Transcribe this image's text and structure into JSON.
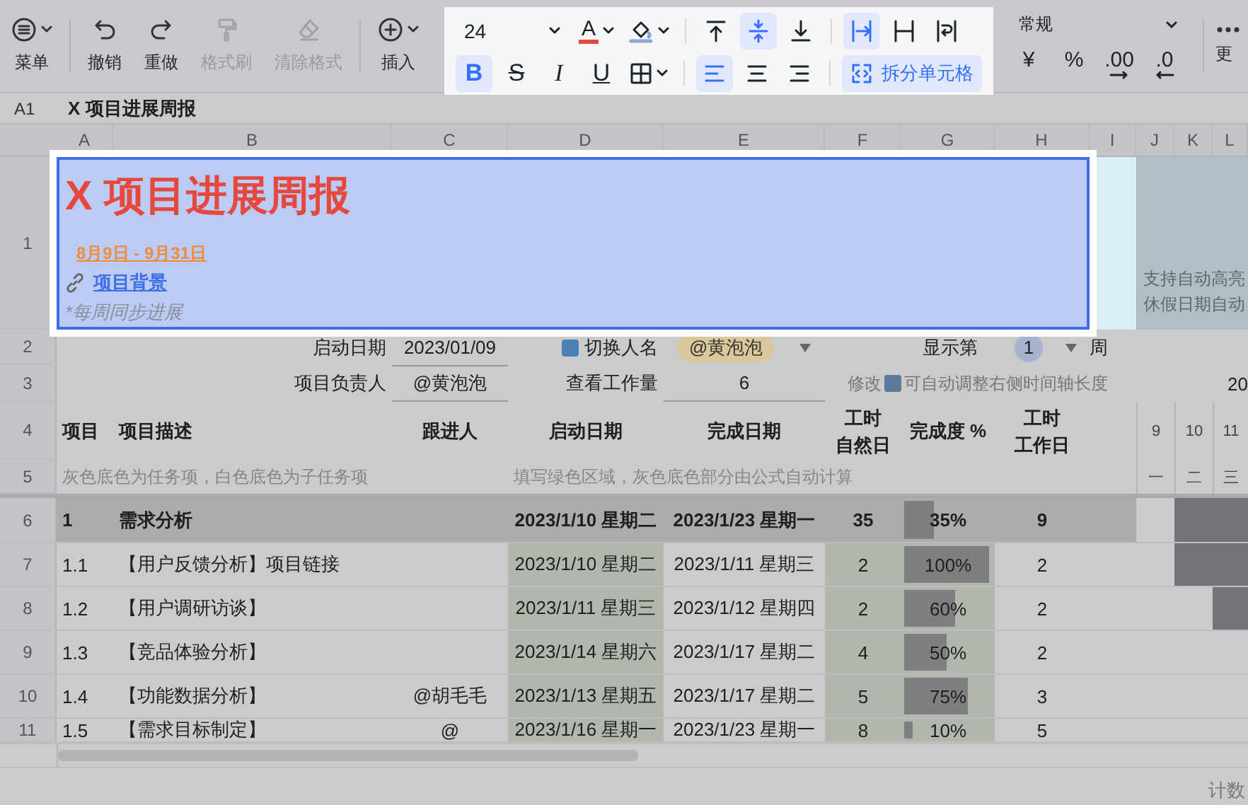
{
  "toolbar": {
    "items": [
      {
        "kind": "menu",
        "label": "菜单",
        "disabled": false
      },
      {
        "kind": "undo",
        "label": "撤销",
        "disabled": false
      },
      {
        "kind": "redo",
        "label": "重做",
        "disabled": false
      },
      {
        "kind": "painter",
        "label": "格式刷",
        "disabled": true
      },
      {
        "kind": "clear",
        "label": "清除格式",
        "disabled": true
      },
      {
        "kind": "insert",
        "label": "插入",
        "disabled": false
      }
    ],
    "format_panel": {
      "font_size": "24",
      "font_color_glyph": "A",
      "vertical_align": [
        {
          "kind": "top",
          "selected": false
        },
        {
          "kind": "middle",
          "selected": true
        },
        {
          "kind": "bottom",
          "selected": false
        }
      ],
      "wrap_modes": [
        {
          "kind": "overflow",
          "selected": true
        },
        {
          "kind": "clip",
          "selected": false
        },
        {
          "kind": "wrap",
          "selected": false
        }
      ],
      "text_styles": [
        {
          "kind": "bold",
          "glyph": "B",
          "selected": true
        },
        {
          "kind": "strike",
          "glyph": "S",
          "selected": false
        },
        {
          "kind": "italic",
          "glyph": "I",
          "selected": false
        },
        {
          "kind": "underline",
          "glyph": "U",
          "selected": false
        }
      ],
      "horizontal_align": [
        {
          "kind": "left",
          "selected": true
        },
        {
          "kind": "center",
          "selected": false
        },
        {
          "kind": "right",
          "selected": false
        }
      ],
      "split_button": {
        "label": "拆分单元格",
        "selected": true
      }
    },
    "number_format": {
      "format": "常规",
      "buttons": [
        {
          "kind": "currency",
          "glyph": "¥"
        },
        {
          "kind": "percent",
          "glyph": "%"
        },
        {
          "kind": "increase-decimal",
          "glyph": ".00"
        },
        {
          "kind": "decrease-decimal",
          "glyph": ".0"
        }
      ]
    },
    "more": {
      "label": "更"
    }
  },
  "formula_bar": {
    "cell_ref": "A1",
    "content": "X 项目进展周报"
  },
  "columns": [
    "A",
    "B",
    "C",
    "D",
    "E",
    "F",
    "G",
    "H",
    "I",
    "J",
    "K",
    "L"
  ],
  "row_numbers": [
    "1",
    "2",
    "3",
    "4",
    "5",
    "6",
    "7",
    "8",
    "9",
    "10",
    "11"
  ],
  "sheet": {
    "title": "X 项目进展周报",
    "date_range": "8月9日 - 9月31日",
    "link": "项目背景",
    "note": "*每周同步进展",
    "side_note": [
      "支持自动高亮",
      "休假日期自动"
    ],
    "start_label": "启动日期",
    "start_value": "2023/01/09",
    "switch_label": "切换人名",
    "person": "@黄泡泡",
    "week_label": "显示第",
    "week_value": "1",
    "week_unit": "周",
    "owner_label": "项目负责人",
    "owner_value": "@黄泡泡",
    "workload_label": "查看工作量",
    "workload_value": "6",
    "hint_before": "修改",
    "hint_after": "可自动调整右侧时间轴长度",
    "year": "20",
    "headers": [
      [
        "项目"
      ],
      [
        "项目描述"
      ],
      [
        "跟进人"
      ],
      [
        "启动日期"
      ],
      [
        "完成日期"
      ],
      [
        "工时",
        "自然日"
      ],
      [
        "完成度 %"
      ],
      [
        "工时",
        "工作日"
      ]
    ],
    "days": [
      {
        "day": "9",
        "weekday": "一"
      },
      {
        "day": "10",
        "weekday": "二"
      },
      {
        "day": "11",
        "weekday": "三"
      }
    ],
    "note_left": "灰色底色为任务项，白色底色为子任务项",
    "note_right": "填写绿色区域，灰色底色部分由公式自动计算",
    "tasks": [
      {
        "kind": "task",
        "id": "1",
        "name": "需求分析",
        "start": "2023/1/10 星期二",
        "end": "2023/1/23 星期一",
        "days": "35",
        "progress": "35%",
        "level": 0.35,
        "workdays": "9",
        "gantt": [
          false,
          true,
          true
        ]
      },
      {
        "kind": "subtask",
        "id": "1.1",
        "name": "【用户反馈分析】项目链接",
        "start": "2023/1/10 星期二",
        "end": "2023/1/11 星期三",
        "days": "2",
        "progress": "100%",
        "level": 1,
        "workdays": "2",
        "gantt": [
          false,
          true,
          true
        ]
      },
      {
        "kind": "subtask",
        "id": "1.2",
        "name": "【用户调研访谈】",
        "start": "2023/1/11 星期三",
        "end": "2023/1/12 星期四",
        "days": "2",
        "progress": "60%",
        "level": 0.6,
        "workdays": "2",
        "gantt": [
          false,
          false,
          true
        ]
      },
      {
        "kind": "subtask",
        "id": "1.3",
        "name": "【竞品体验分析】",
        "start": "2023/1/14 星期六",
        "end": "2023/1/17 星期二",
        "days": "4",
        "progress": "50%",
        "level": 0.5,
        "workdays": "2",
        "gantt": [
          false,
          false,
          false
        ]
      },
      {
        "kind": "subtask",
        "id": "1.4",
        "name": "【功能数据分析】",
        "owner": "@胡毛毛",
        "start": "2023/1/13 星期五",
        "end": "2023/1/17 星期二",
        "days": "5",
        "progress": "75%",
        "level": 0.75,
        "workdays": "3",
        "gantt": [
          false,
          false,
          false
        ]
      },
      {
        "kind": "subtask",
        "id": "1.5",
        "name": "【需求目标制定】",
        "owner": "@",
        "start": "2023/1/16 星期一",
        "end": "2023/1/23 星期一",
        "days": "8",
        "progress": "10%",
        "level": 0.1,
        "workdays": "5",
        "gantt": [
          false,
          false,
          false
        ]
      }
    ]
  },
  "status_bar": {
    "label": "计数"
  }
}
